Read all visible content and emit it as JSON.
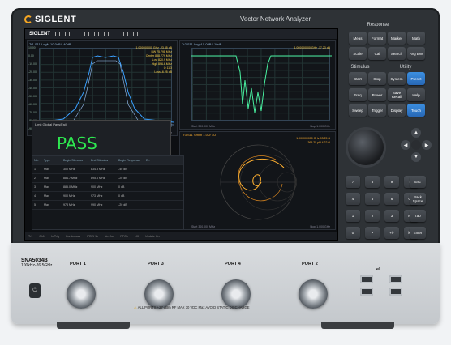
{
  "brand": "SIGLENT",
  "product": "Vector Network Analyzer",
  "model": "SNA5034B",
  "frequency_range": "100kHz-26.5GHz",
  "screen": {
    "toolbar_brand": "SIGLENT",
    "trace1_header": "Tr1  S11 LogM 10.0dB/ -40dB",
    "trace2_header": "Tr2  S11 LogM 5.0dB/ -10dB",
    "trace3_header": "Tr3  S11 Smith  1.0U/  1U",
    "markers_tr1": [
      "1.000000000 GHz  -23.85 dB",
      "BW  75.798 MHz",
      "Center  858.779 MHz",
      "Low  820.9 MHz",
      "High  896.6 MHz",
      "Q  11.3",
      "Loss  -6.25 dB"
    ],
    "markers_tr2": [
      "1.000000000 GHz  -17.23 dB"
    ],
    "markers_tr3": [
      "1.000000000 GHz  93.25 Ω",
      "365.25 pH  4.22 Ω"
    ],
    "limit_title": "Limit Global Pass/Fail",
    "pass_text": "PASS",
    "pass_small": "Tr1  PASS",
    "table_headers": [
      "No.",
      "Type",
      "Begin Stimulus",
      "End Stimulus",
      "Begin Response",
      "En"
    ],
    "table_rows": [
      [
        "1",
        "Max",
        "300 MHz",
        "834.8 MHz",
        "-40 dB"
      ],
      [
        "2",
        "Max",
        "884.7 MHz",
        "895.6 MHz",
        "-20 dB"
      ],
      [
        "3",
        "Max",
        "885.0 MHz",
        "900 MHz",
        "0 dB"
      ],
      [
        "4",
        "Max",
        "900 MHz",
        "973 MHz",
        "0 dB"
      ],
      [
        "5",
        "Max",
        "973 MHz",
        "990 MHz",
        "-20 dB"
      ]
    ],
    "status_items": [
      "Tr1",
      "Ch1",
      "IntTrig",
      "Continuous",
      "IFBW 1k",
      "No Cor",
      "RFOn",
      "LXI",
      "Update On"
    ],
    "yticks_tr1": [
      "10.00",
      "0.00",
      "-10.00",
      "-20.00",
      "-30.00",
      "-40.00",
      "-50.00",
      "-60.00",
      "-70.00",
      "-80.00",
      "-90.00"
    ],
    "xlab_start": "Start 300.000 MHz",
    "xlab_stop": "Stop 1.000 GHz"
  },
  "panel": {
    "response": "Response",
    "stimulus": "Stimulus",
    "utility": "Utility",
    "keys": [
      "Meas",
      "Format",
      "Marker",
      "Math",
      "Scale",
      "Cal",
      "Search",
      "Avg BW",
      "Start",
      "Stop",
      "System",
      "Preset",
      "Freq",
      "Power",
      "Save Recall",
      "Help",
      "Sweep",
      "Trigger",
      "Display",
      "Touch"
    ],
    "numpad": [
      "7",
      "8",
      "9",
      "T/p",
      "Esc",
      "4",
      "5",
      "6",
      "G/n",
      "Back Space",
      "1",
      "2",
      "3",
      "M/μ",
      "Tab",
      "0",
      "•",
      "+/-",
      "k/m",
      "Enter"
    ]
  },
  "ports": [
    "PORT 1",
    "PORT 3",
    "PORT 4",
    "PORT 2"
  ],
  "warning": "ALL PORTS +27 dBm RF MAX  30 VDC Max  AVOID STATIC DISCHARGE",
  "colors": {
    "trace_blue": "#3aa0ff",
    "trace_green": "#49f0a0",
    "smith_orange": "#ffb030",
    "pass_green": "#2ee650",
    "accent_blue": "#2d7fd2"
  }
}
